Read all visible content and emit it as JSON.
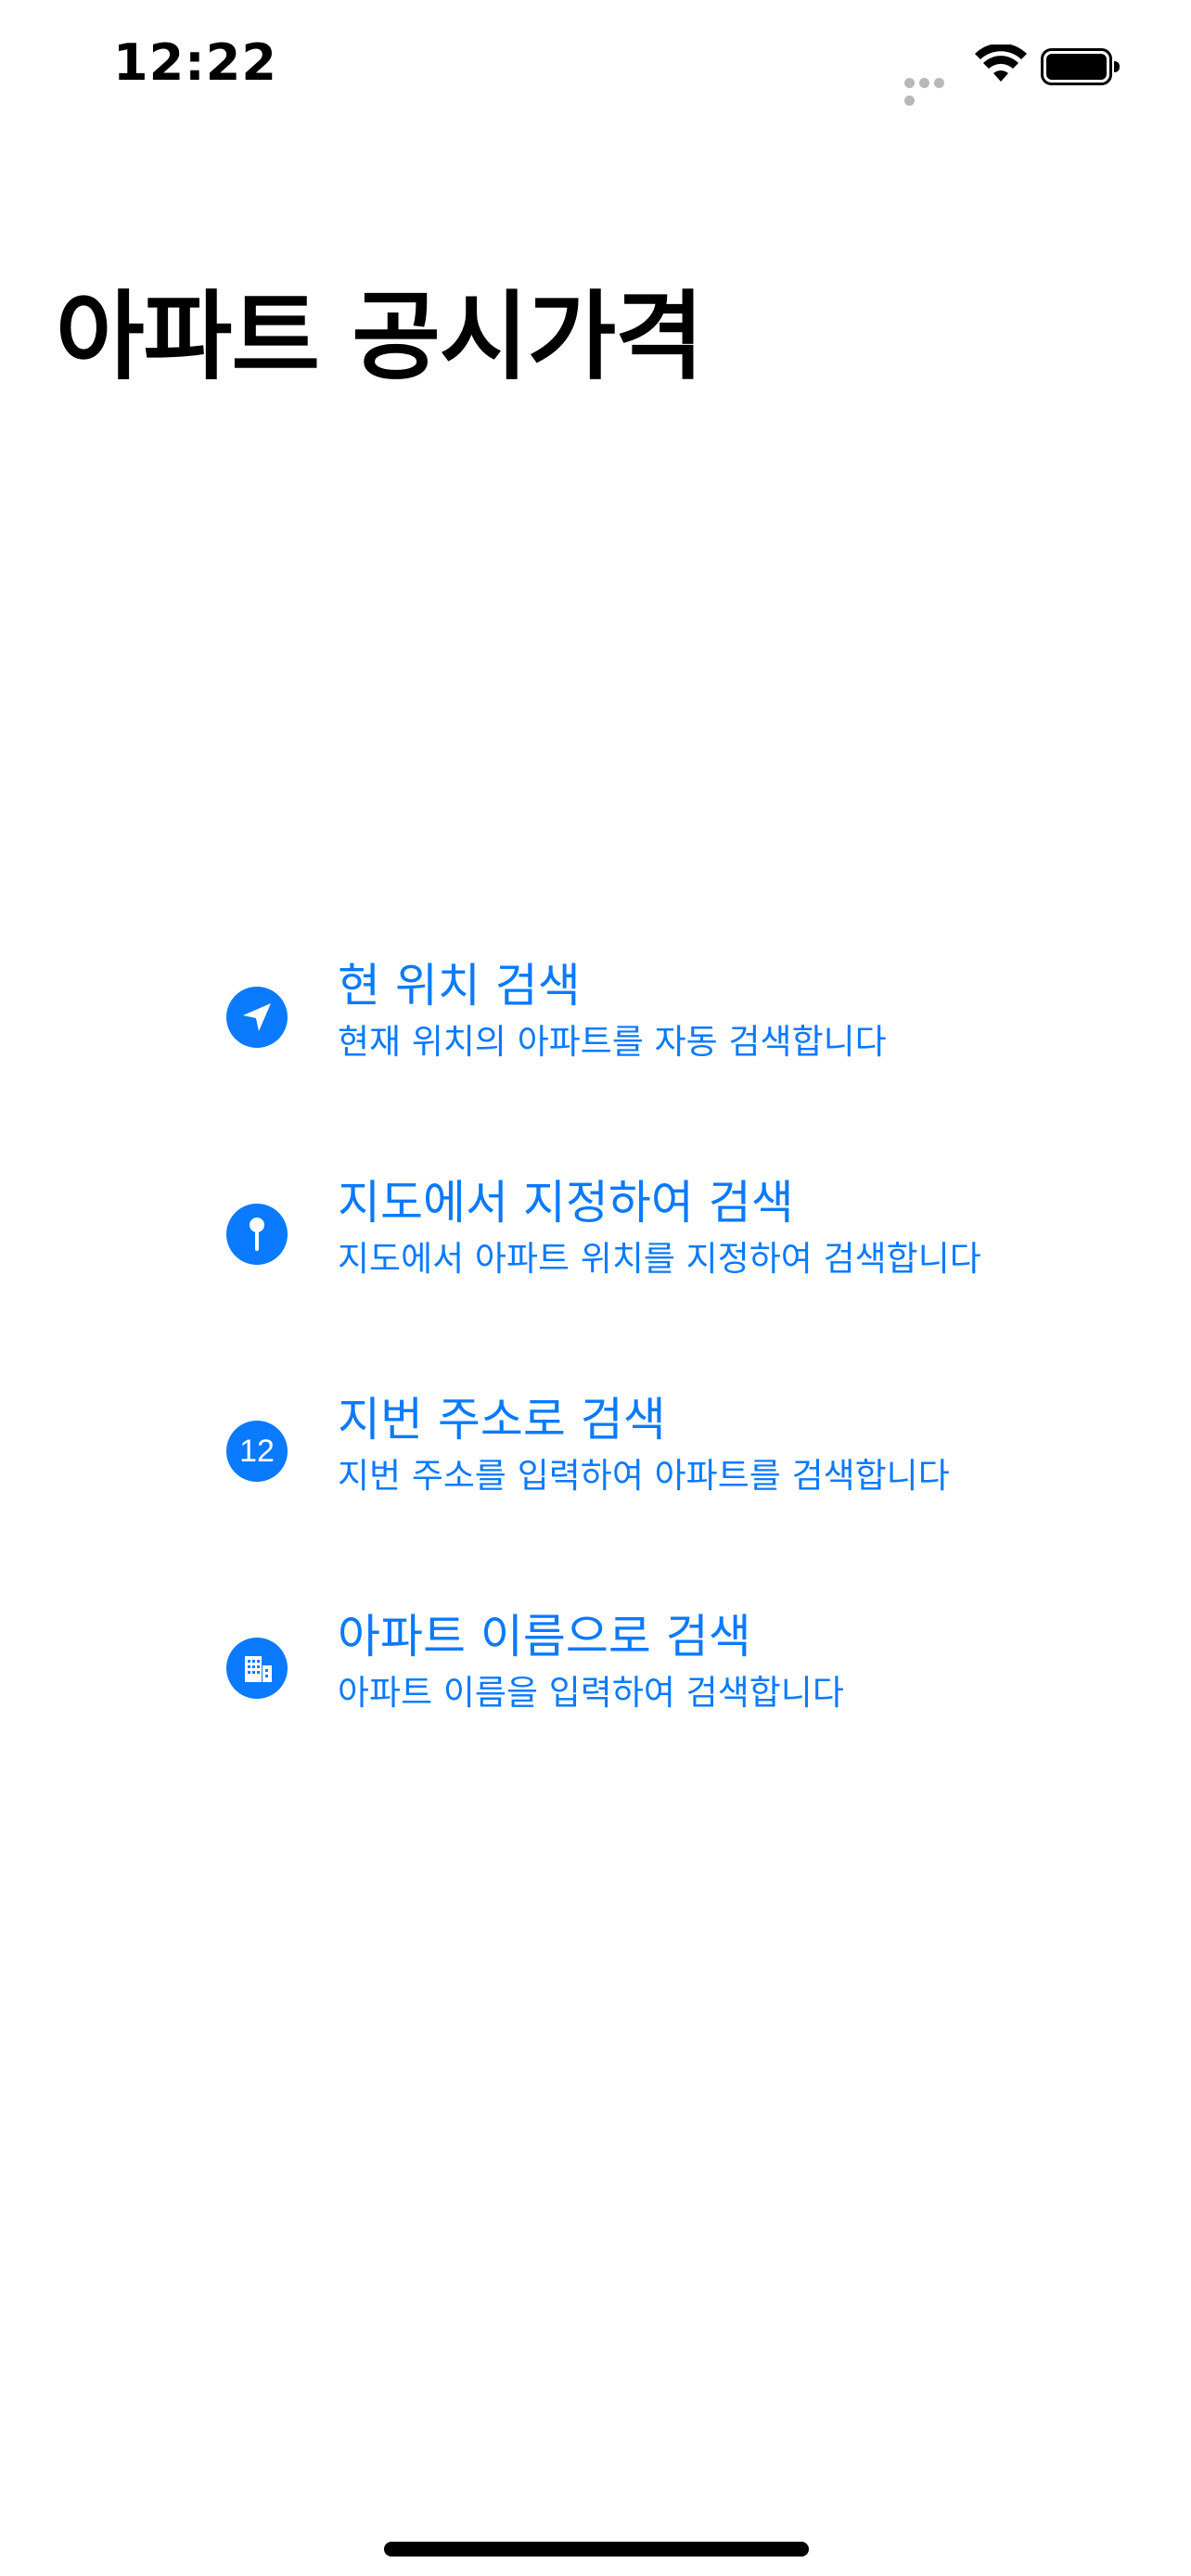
{
  "status_bar": {
    "time": "12:22"
  },
  "header": {
    "title": "아파트 공시가격"
  },
  "colors": {
    "accent": "#0A7AFF",
    "text": "#000000",
    "background": "#FFFFFF"
  },
  "menu": {
    "items": [
      {
        "icon": "location-arrow-icon",
        "title": "현 위치 검색",
        "subtitle": "현재 위치의 아파트를 자동 검색합니다"
      },
      {
        "icon": "map-pin-icon",
        "title": "지도에서 지정하여 검색",
        "subtitle": "지도에서 아파트 위치를 지정하여 검색합니다"
      },
      {
        "icon": "number-12-icon",
        "icon_text": "12",
        "title": "지번 주소로 검색",
        "subtitle": "지번 주소를 입력하여 아파트를 검색합니다"
      },
      {
        "icon": "building-icon",
        "title": "아파트 이름으로 검색",
        "subtitle": "아파트 이름을 입력하여 검색합니다"
      }
    ]
  }
}
